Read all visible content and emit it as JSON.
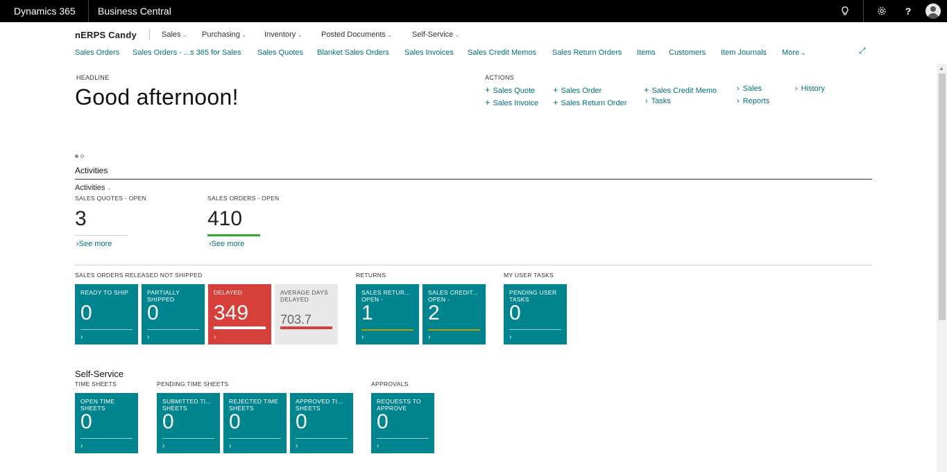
{
  "topbar": {
    "brand": "Dynamics 365",
    "product": "Business Central",
    "icons": [
      "lightbulb-icon",
      "gear-icon",
      "help-icon",
      "avatar-icon"
    ],
    "help_label": "?"
  },
  "nav": {
    "company": "nERPS Candy",
    "menus": [
      "Sales",
      "Purchasing",
      "Inventory",
      "Posted Documents",
      "Self-Service"
    ],
    "links": [
      "Sales Orders",
      "Sales Orders - ...s 365 for Sales",
      "Sales Quotes",
      "Blanket Sales Orders",
      "Sales Invoices",
      "Sales Credit Memos",
      "Sales Return Orders",
      "Items",
      "Customers",
      "Item Journals",
      "More"
    ]
  },
  "headline": {
    "label": "HEADLINE",
    "greeting": "Good afternoon!"
  },
  "actions": {
    "label": "ACTIONS",
    "items": [
      "Sales Quote",
      "Sales Invoice",
      "Sales Order",
      "Sales Return Order",
      "Sales Credit Memo",
      "Tasks",
      "Sales",
      "Reports",
      "History"
    ]
  },
  "activities": {
    "title": "Activities",
    "dropdown": "Activities",
    "cues": [
      {
        "label": "SALES QUOTES - OPEN",
        "value": "3",
        "see_more": "See more"
      },
      {
        "label": "SALES ORDERS - OPEN",
        "value": "410",
        "see_more": "See more"
      }
    ],
    "groups": {
      "released": "SALES ORDERS RELEASED NOT SHIPPED",
      "returns": "RETURNS",
      "user_tasks": "MY USER TASKS"
    },
    "tiles": [
      {
        "label": "READY TO SHIP",
        "value": "0"
      },
      {
        "label": "PARTIALLY SHIPPED",
        "value": "0"
      },
      {
        "label": "DELAYED",
        "value": "349"
      },
      {
        "label": "AVERAGE DAYS DELAYED",
        "value": "703.7"
      },
      {
        "label": "SALES RETUR... OPEN -",
        "value": "1"
      },
      {
        "label": "SALES CREDIT... OPEN -",
        "value": "2"
      },
      {
        "label": "PENDING USER TASKS",
        "value": "0"
      }
    ]
  },
  "selfservice": {
    "title": "Self-Service",
    "groups": {
      "time_sheets": "TIME SHEETS",
      "pending": "PENDING TIME SHEETS",
      "approvals": "APPROVALS"
    },
    "tiles": [
      {
        "label": "OPEN TIME SHEETS",
        "value": "0"
      },
      {
        "label": "SUBMITTED TI... SHEETS",
        "value": "0"
      },
      {
        "label": "REJECTED TIME SHEETS",
        "value": "0"
      },
      {
        "label": "APPROVED TI... SHEETS",
        "value": "0"
      },
      {
        "label": "REQUESTS TO APPROVE",
        "value": "0"
      }
    ]
  },
  "colors": {
    "accent": "#00707a",
    "tile": "#00858e",
    "danger": "#d7403a",
    "cue_green": "#2ea82e"
  }
}
